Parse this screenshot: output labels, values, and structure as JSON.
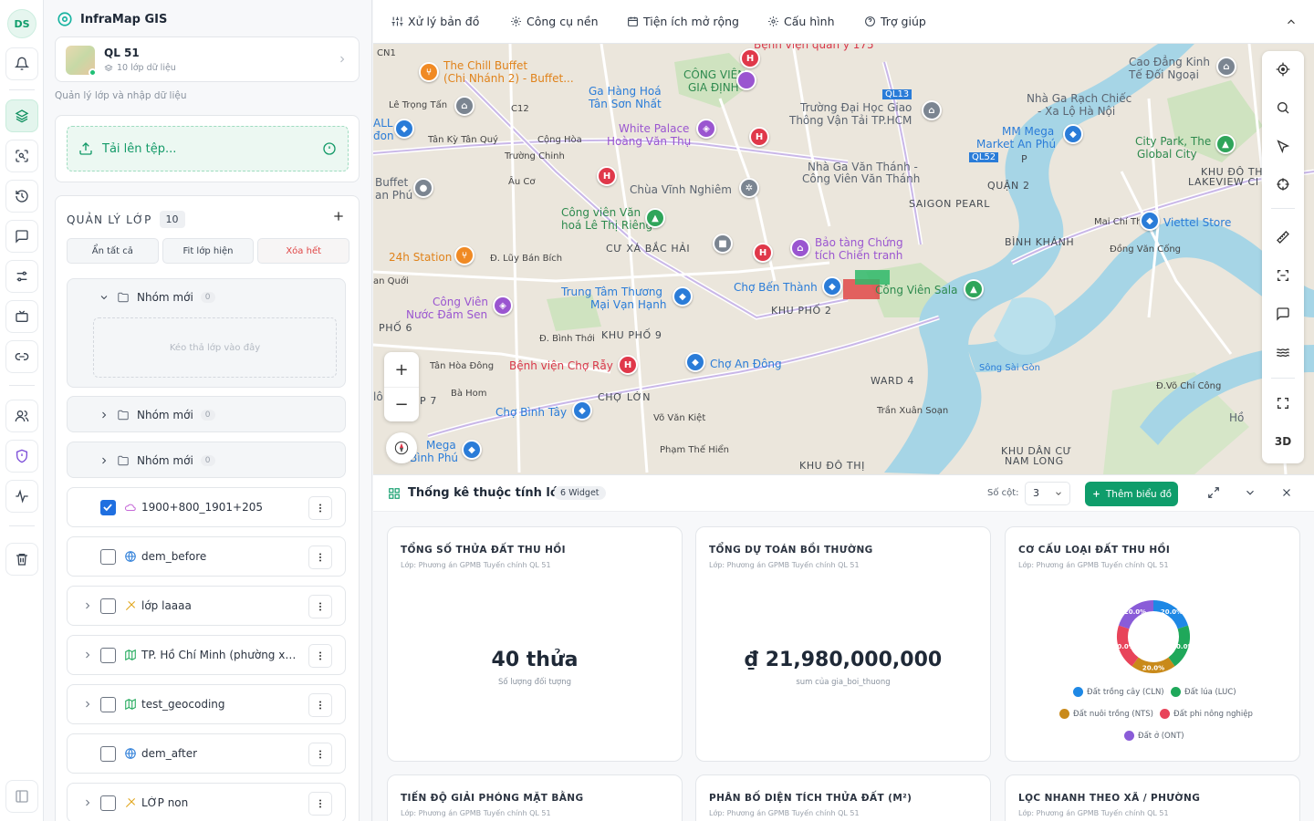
{
  "user": {
    "initials": "DS"
  },
  "app": {
    "title": "InfraMap GIS"
  },
  "project": {
    "name": "QL 51",
    "layers_count": "10 lớp dữ liệu"
  },
  "sidebar": {
    "caption": "Quản lý lớp và nhập dữ liệu",
    "upload_label": "Tải lên tệp...",
    "layers_title": "QUẢN LÝ LỚP",
    "layers_count": "10",
    "actions": {
      "hide_all": "Ẩn tất cả",
      "fit_visible": "Fit lớp hiện",
      "delete_all": "Xóa hết"
    },
    "groups": [
      {
        "name": "Nhóm mới",
        "count": "0",
        "expanded": true,
        "dropzone": "Kéo thả lớp vào đây"
      },
      {
        "name": "Nhóm mới",
        "count": "0",
        "expanded": false
      },
      {
        "name": "Nhóm mới",
        "count": "0",
        "expanded": false
      }
    ],
    "layers": [
      {
        "name": "1900+800_1901+205",
        "checked": true,
        "icon": "polygon-icon",
        "expandable": false
      },
      {
        "name": "dem_before",
        "checked": false,
        "icon": "globe-icon",
        "expandable": false
      },
      {
        "name": "lớp laaaa",
        "checked": false,
        "icon": "line-icon",
        "expandable": true
      },
      {
        "name": "TP. Hồ Chí Minh (phường xã) -...",
        "checked": false,
        "icon": "map-icon",
        "expandable": true
      },
      {
        "name": "test_geocoding",
        "checked": false,
        "icon": "map-icon",
        "expandable": true
      },
      {
        "name": "dem_after",
        "checked": false,
        "icon": "globe-icon",
        "expandable": false
      },
      {
        "name": "LỚP non",
        "checked": false,
        "icon": "line-icon",
        "expandable": true
      }
    ]
  },
  "topnav": {
    "items": [
      "Xử lý bản đồ",
      "Công cụ nền",
      "Tiện ích mở rộng",
      "Cấu hình",
      "Trợ giúp"
    ]
  },
  "map": {
    "labels": {
      "chill": "The Chill Buffet",
      "chill2": "(Chi Nhánh 2) - Buffet...",
      "cvgd": "CÔNG VIÊN",
      "cvgd2": "GIA ĐỊNH",
      "gahang": "Ga Hàng Hoá",
      "gahang2": "Tân Sơn Nhất",
      "white": "White Palace",
      "white2": "Hoàng Văn Thụ",
      "chua": "Chùa Vĩnh Nghiêm",
      "cvvh": "Công viên Văn",
      "cvvh2": "hoá Lê Thị Riêng",
      "cxbh": "CƯ XÁ BẮC HẢI",
      "bt": "Bảo tàng Chứng",
      "bt2": "tích Chiến tranh",
      "cbt": "Chợ Bến Thành",
      "cvsala": "Công Viên Sala",
      "tttm": "Trung Tâm Thương",
      "tttm2": "Mại Vạn Hạnh",
      "cvdam": "Công Viên",
      "cvdam2": "Nước Đầm Sen",
      "kp2": "KHU PHỐ 2",
      "kp9": "KHU PHỐ 9",
      "bvcr": "Bệnh viện Chợ Rẫy",
      "cad": "Chợ An Đông",
      "cl": "CHỢ LỚN",
      "cbtay": "Chợ Bình Tây",
      "ward4": "WARD 4",
      "truongdh": "Trường Đại Học Giao",
      "truongdh2": "Thông Vận Tải TP.HCM",
      "nhaga": "Nhà Ga Văn Thánh -",
      "nhaga2": "Công Viên Văn Thánh",
      "saigon": "SAIGON PEARL",
      "quan2": "QUẬN 2",
      "binhkhanh": "BÌNH KHÁNH",
      "mmmega": "MM Mega",
      "mmmega2": "Market An Phú",
      "citypark": "City Park, The",
      "citypark2": "Global City",
      "caodang": "Cao Đẳng Kinh",
      "caodang2": "Tế Đối Ngoại",
      "nhagarc": "Nhà Ga Rạch Chiếc",
      "nhagarc2": "- Xa Lộ Hà Nội",
      "viettel": "Viettel Store",
      "khudt": "KHU ĐÔ THỊ",
      "khudt2": "LAKEVIEW CI",
      "khudan": "KHU DÂN CƯ",
      "khudan2": "NAM LONG",
      "khudothi": "KHU ĐÔ THỊ",
      "station24": "24h Station",
      "mega": "Mega",
      "mega2": "Bình Phú",
      "tranxuan": "Trần Xuân Soạn",
      "songsg": "Sông Sài Gòn",
      "lotrongtan": "Lê Trọng Tấn",
      "tankytq": "Tân Kỳ Tân Quý",
      "conghoa": "Cộng Hòa",
      "truongchinh": "Trường Chinh",
      "aucuo": "Âu Cơ",
      "luybanbich": "Đ. Lũy Bán Bích",
      "binhthoi": "Đ. Bình Thới",
      "vovankiet": "Võ Văn Kiệt",
      "phamthehien": "Phạm Thế Hiển",
      "maichitho": "Mai Chí Thọ",
      "dongvancong": "Đồng Văn Cống",
      "vochicong": "Đ.Võ Chí Công",
      "p6": "PHỐ 6",
      "p7": "P 7",
      "bahom": "Bà Hom",
      "tanhoadong": "Tân Hòa Đông",
      "anquoi": "an Quới",
      "buffet": "Buffet",
      "buffet2": "an Phú",
      "ql13": "QL13",
      "ql52": "QL52",
      "c12": "C12",
      "cn1": "CN1",
      "bvquany": "Bệnh viện quân y 175",
      "all": "ALL",
      "don": "đon",
      "hoc": "Hồ",
      "lo": "lô",
      "p": "P",
      "tai": "TAI"
    },
    "zoom_in": "+",
    "zoom_out": "−",
    "tool_3d": "3D"
  },
  "panel": {
    "title": "Thống kê thuộc tính lớp",
    "widgets": "6 Widget",
    "columns_label": "Số cột:",
    "columns_value": "3",
    "add_chart": "Thêm biểu đồ",
    "source": "Lớp: Phương án GPMB Tuyến chính QL 51",
    "cards": [
      {
        "title": "TỔNG SỐ THỬA ĐẤT THU HỒI",
        "value": "40 thửa",
        "caption": "Số lượng đối tượng"
      },
      {
        "title": "TỔNG DỰ TOÁN BỒI THƯỜNG",
        "value": "₫ 21,980,000,000",
        "caption": "sum của gia_boi_thuong"
      },
      {
        "title": "CƠ CẤU LOẠI ĐẤT THU HỒI"
      },
      {
        "title": "TIẾN ĐỘ GIẢI PHÓNG MẶT BẰNG"
      },
      {
        "title": "PHÂN BỐ DIỆN TÍCH THỬA ĐẤT (M²)"
      },
      {
        "title": "LỌC NHANH THEO XÃ / PHƯỜNG"
      }
    ]
  },
  "chart_data": {
    "type": "pie",
    "title": "CƠ CẤU LOẠI ĐẤT THU HỒI",
    "categories": [
      "Đất trồng cây (CLN)",
      "Đất lúa (LUC)",
      "Đất nuôi trồng (NTS)",
      "Đất phi nông nghiệp",
      "Đất ở (ONT)"
    ],
    "values": [
      20.0,
      20.0,
      20.0,
      20.0,
      20.0
    ],
    "data_labels": [
      "20.0%",
      "20.0%",
      "20.0%",
      "20.0%",
      "20.0%"
    ],
    "colors": [
      "#1e88e5",
      "#1fa85a",
      "#c98a1a",
      "#e8445a",
      "#8a5cd8"
    ],
    "legend": "bottom"
  }
}
